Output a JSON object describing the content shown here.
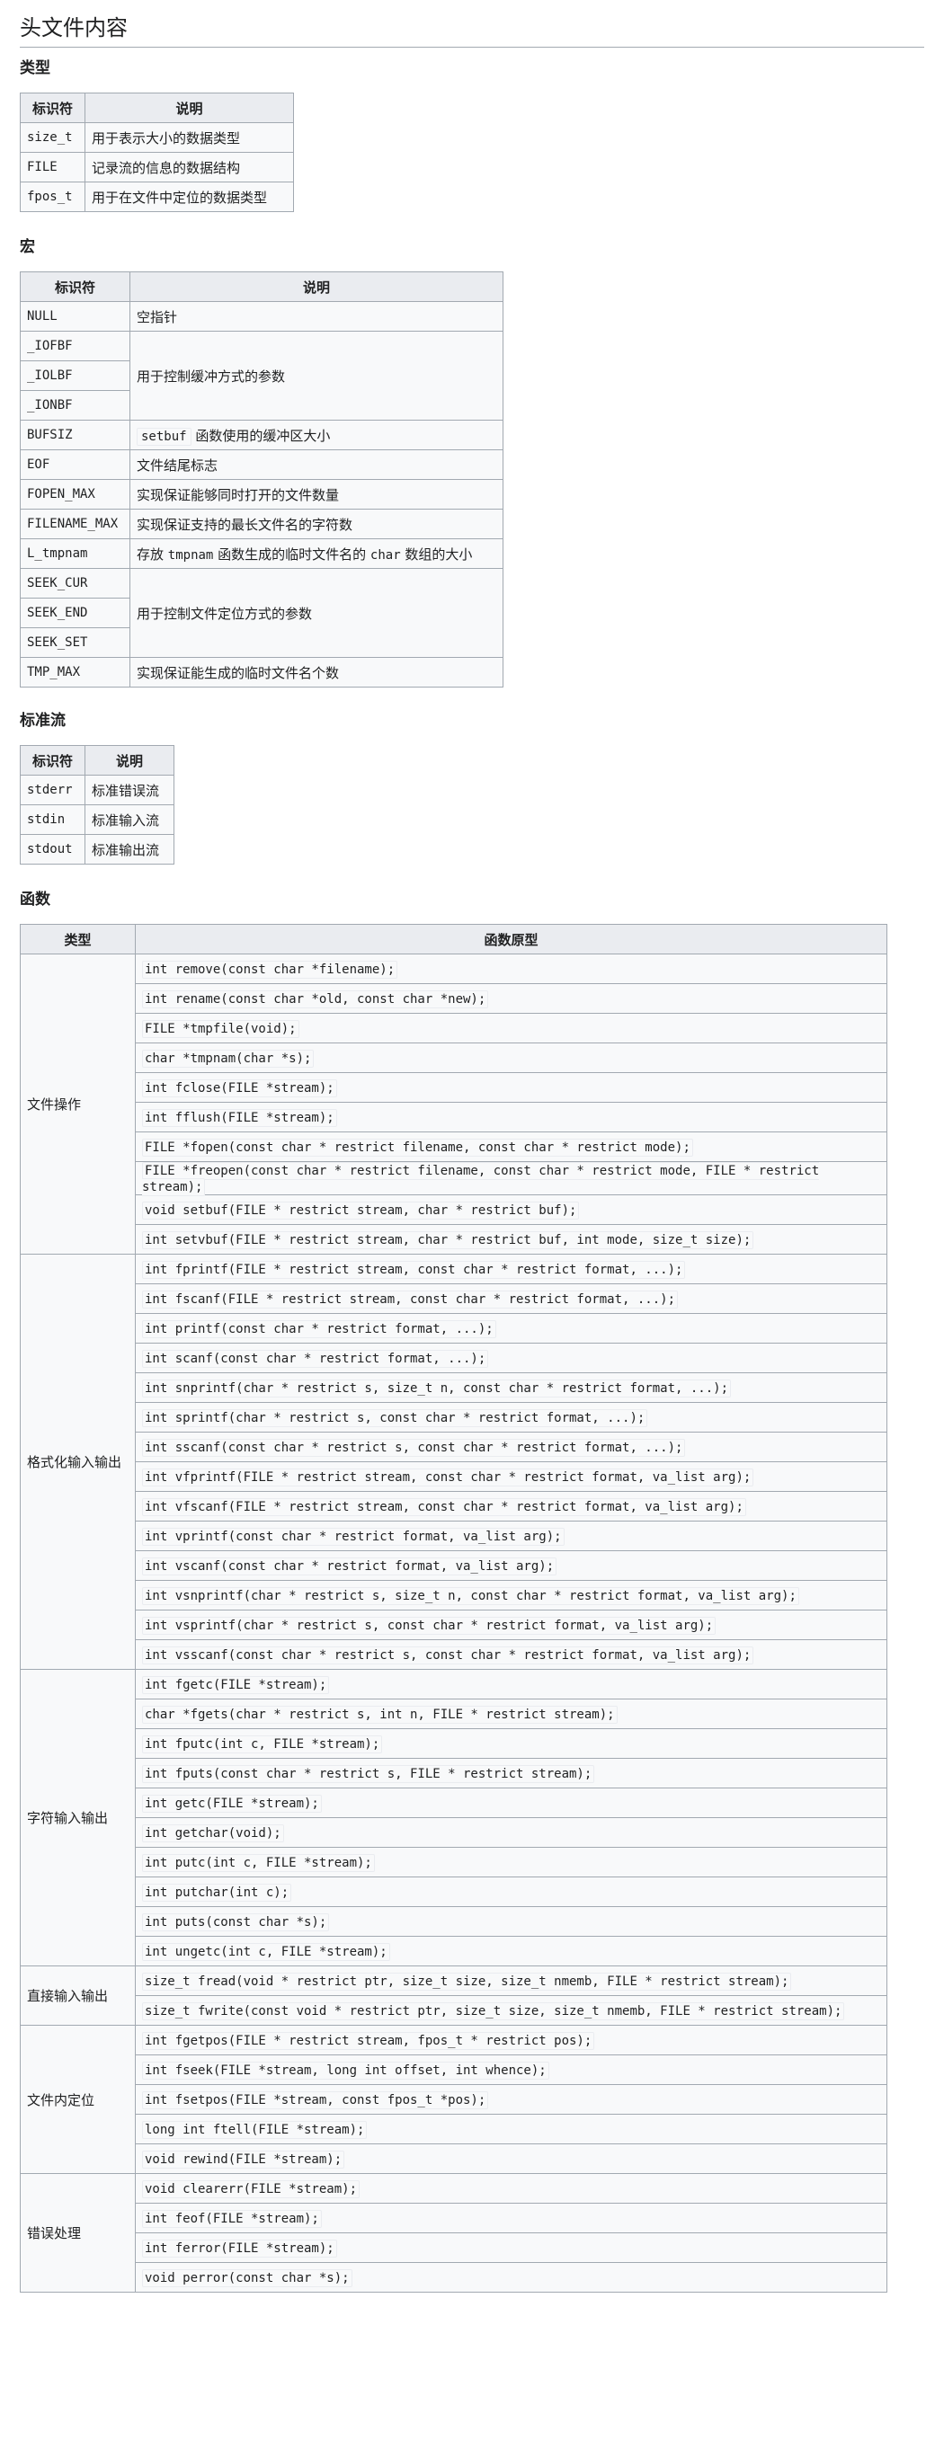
{
  "section_title": "头文件内容",
  "types": {
    "heading": "类型",
    "header": {
      "id": "标识符",
      "desc": "说明"
    },
    "rows": [
      {
        "id": "size_t",
        "desc": "用于表示大小的数据类型"
      },
      {
        "id": "FILE",
        "desc": "记录流的信息的数据结构"
      },
      {
        "id": "fpos_t",
        "desc": "用于在文件中定位的数据类型"
      }
    ]
  },
  "macros": {
    "heading": "宏",
    "header": {
      "id": "标识符",
      "desc": "说明"
    },
    "ids": [
      "NULL",
      "_IOFBF",
      "_IOLBF",
      "_IONBF",
      "BUFSIZ",
      "EOF",
      "FOPEN_MAX",
      "FILENAME_MAX",
      "L_tmpnam",
      "SEEK_CUR",
      "SEEK_END",
      "SEEK_SET",
      "TMP_MAX"
    ],
    "desc_null": "空指针",
    "desc_buffer": "用于控制缓冲方式的参数",
    "desc_bufsiz_code": "setbuf",
    "desc_bufsiz_text": " 函数使用的缓冲区大小",
    "desc_eof": "文件结尾标志",
    "desc_fopen_max": "实现保证能够同时打开的文件数量",
    "desc_filename_max": "实现保证支持的最长文件名的字符数",
    "desc_ltmpnam_pre": "存放 ",
    "desc_ltmpnam_code1": "tmpnam",
    "desc_ltmpnam_mid": " 函数生成的临时文件名的 ",
    "desc_ltmpnam_code2": "char",
    "desc_ltmpnam_post": " 数组的大小",
    "desc_seek": "用于控制文件定位方式的参数",
    "desc_tmp_max": "实现保证能生成的临时文件名个数"
  },
  "streams": {
    "heading": "标准流",
    "header": {
      "id": "标识符",
      "desc": "说明"
    },
    "rows": [
      {
        "id": "stderr",
        "desc": "标准错误流"
      },
      {
        "id": "stdin",
        "desc": "标准输入流"
      },
      {
        "id": "stdout",
        "desc": "标准输出流"
      }
    ]
  },
  "functions": {
    "heading": "函数",
    "header": {
      "type": "类型",
      "proto": "函数原型"
    },
    "groups": [
      {
        "type": "文件操作",
        "protos": [
          "int remove(const char *filename);",
          "int rename(const char *old, const char *new);",
          "FILE *tmpfile(void);",
          "char *tmpnam(char *s);",
          "int fclose(FILE *stream);",
          "int fflush(FILE *stream);",
          "FILE *fopen(const char * restrict filename, const char * restrict mode);",
          "FILE *freopen(const char * restrict filename, const char * restrict mode, FILE * restrict stream);",
          "void setbuf(FILE * restrict stream, char * restrict buf);",
          "int setvbuf(FILE * restrict stream, char * restrict buf, int mode, size_t size);"
        ]
      },
      {
        "type": "格式化输入输出",
        "protos": [
          "int fprintf(FILE * restrict stream, const char * restrict format, ...);",
          "int fscanf(FILE * restrict stream, const char * restrict format, ...);",
          "int printf(const char * restrict format, ...);",
          "int scanf(const char * restrict format, ...);",
          "int snprintf(char * restrict s, size_t n, const char * restrict format, ...);",
          "int sprintf(char * restrict s, const char * restrict format, ...);",
          "int sscanf(const char * restrict s, const char * restrict format, ...);",
          "int vfprintf(FILE * restrict stream, const char * restrict format, va_list arg);",
          "int vfscanf(FILE * restrict stream, const char * restrict format, va_list arg);",
          "int vprintf(const char * restrict format, va_list arg);",
          "int vscanf(const char * restrict format, va_list arg);",
          "int vsnprintf(char * restrict s, size_t n, const char * restrict format, va_list arg);",
          "int vsprintf(char * restrict s, const char * restrict format, va_list arg);",
          "int vsscanf(const char * restrict s, const char * restrict format, va_list arg);"
        ]
      },
      {
        "type": "字符输入输出",
        "protos": [
          "int fgetc(FILE *stream);",
          "char *fgets(char * restrict s, int n, FILE * restrict stream);",
          "int fputc(int c, FILE *stream);",
          "int fputs(const char * restrict s, FILE * restrict stream);",
          "int getc(FILE *stream);",
          "int getchar(void);",
          "int putc(int c, FILE *stream);",
          "int putchar(int c);",
          "int puts(const char *s);",
          "int ungetc(int c, FILE *stream);"
        ]
      },
      {
        "type": "直接输入输出",
        "protos": [
          "size_t fread(void * restrict ptr, size_t size, size_t nmemb, FILE * restrict stream);",
          "size_t fwrite(const void * restrict ptr, size_t size, size_t nmemb, FILE * restrict stream);"
        ]
      },
      {
        "type": "文件内定位",
        "protos": [
          "int fgetpos(FILE * restrict stream, fpos_t * restrict pos);",
          "int fseek(FILE *stream, long int offset, int whence);",
          "int fsetpos(FILE *stream, const fpos_t *pos);",
          "long int ftell(FILE *stream);",
          "void rewind(FILE *stream);"
        ]
      },
      {
        "type": "错误处理",
        "protos": [
          "void clearerr(FILE *stream);",
          "int feof(FILE *stream);",
          "int ferror(FILE *stream);",
          "void perror(const char *s);"
        ]
      }
    ]
  }
}
